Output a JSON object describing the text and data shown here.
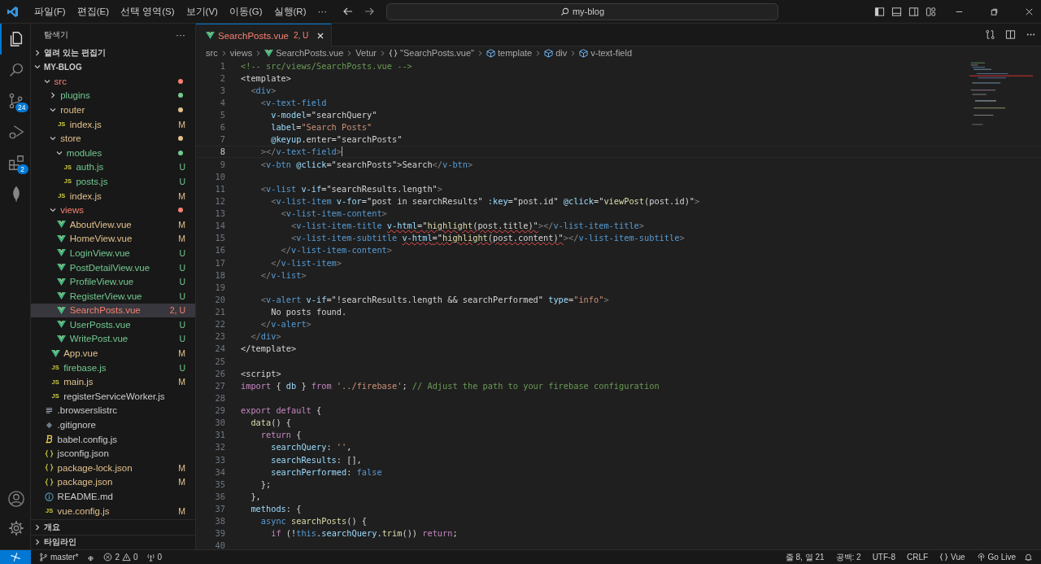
{
  "menu": [
    "파일(F)",
    "편집(E)",
    "선택 영역(S)",
    "보기(V)",
    "이동(G)",
    "실행(R)"
  ],
  "menu_more": "···",
  "command_center": {
    "value": "my-blog"
  },
  "activity_bar": [
    {
      "kind": "explorer",
      "selected": true
    },
    {
      "kind": "search",
      "selected": false
    },
    {
      "kind": "source-control",
      "selected": false,
      "badge": "24"
    },
    {
      "kind": "run",
      "selected": false
    },
    {
      "kind": "extensions",
      "selected": false,
      "badge": "2"
    },
    {
      "kind": "leaf",
      "selected": false
    }
  ],
  "activity_bottom": [
    {
      "kind": "account"
    },
    {
      "kind": "settings"
    }
  ],
  "explorer": {
    "title": "탐색기",
    "more": "···",
    "open_editors": {
      "label": "열려 있는 편집기",
      "expanded": false
    },
    "root": {
      "label": "MY-BLOG",
      "expanded": true
    },
    "tree": [
      {
        "name": "src",
        "kind": "folder",
        "color": "#f88070",
        "expanded": true,
        "selected": false,
        "children": [
          {
            "name": "plugins",
            "kind": "folder",
            "color": "#73c991",
            "expanded": false,
            "selected": false
          },
          {
            "name": "router",
            "kind": "folder",
            "color": "#e2c08d",
            "expanded": true,
            "selected": false,
            "children": [
              {
                "name": "index.js",
                "kind": "js",
                "icon_label": "JS",
                "color": "#e2c08d",
                "badge": "M",
                "selected": false
              }
            ]
          },
          {
            "name": "store",
            "kind": "folder",
            "color": "#e2c08d",
            "expanded": true,
            "selected": false,
            "children": [
              {
                "name": "modules",
                "kind": "folder",
                "color": "#73c991",
                "expanded": true,
                "selected": false,
                "children": [
                  {
                    "name": "auth.js",
                    "kind": "js",
                    "icon_label": "JS",
                    "color": "#73c991",
                    "badge": "U",
                    "selected": false
                  },
                  {
                    "name": "posts.js",
                    "kind": "js",
                    "icon_label": "JS",
                    "color": "#73c991",
                    "badge": "U",
                    "selected": false
                  }
                ]
              },
              {
                "name": "index.js",
                "kind": "js",
                "icon_label": "JS",
                "color": "#e2c08d",
                "badge": "M",
                "selected": false
              }
            ]
          },
          {
            "name": "views",
            "kind": "folder",
            "color": "#f88070",
            "expanded": true,
            "selected": false,
            "children": [
              {
                "name": "AboutView.vue",
                "kind": "vue",
                "color": "#e2c08d",
                "badge": "M",
                "selected": false
              },
              {
                "name": "HomeView.vue",
                "kind": "vue",
                "color": "#e2c08d",
                "badge": "M",
                "selected": false
              },
              {
                "name": "LoginView.vue",
                "kind": "vue",
                "color": "#73c991",
                "badge": "U",
                "selected": false
              },
              {
                "name": "PostDetailView.vue",
                "kind": "vue",
                "color": "#73c991",
                "badge": "U",
                "selected": false
              },
              {
                "name": "ProfileView.vue",
                "kind": "vue",
                "color": "#73c991",
                "badge": "U",
                "selected": false
              },
              {
                "name": "RegisterView.vue",
                "kind": "vue",
                "color": "#73c991",
                "badge": "U",
                "selected": false
              },
              {
                "name": "SearchPosts.vue",
                "kind": "vue",
                "color": "#f88070",
                "badge": "2, U",
                "selected": true
              },
              {
                "name": "UserPosts.vue",
                "kind": "vue",
                "color": "#73c991",
                "badge": "U",
                "selected": false
              },
              {
                "name": "WritePost.vue",
                "kind": "vue",
                "color": "#73c991",
                "badge": "U",
                "selected": false
              }
            ]
          },
          {
            "name": "App.vue",
            "kind": "vue",
            "color": "#e2c08d",
            "badge": "M",
            "selected": false
          },
          {
            "name": "firebase.js",
            "kind": "js",
            "icon_label": "JS",
            "color": "#73c991",
            "badge": "U",
            "selected": false
          },
          {
            "name": "main.js",
            "kind": "js",
            "icon_label": "JS",
            "color": "#e2c08d",
            "badge": "M",
            "selected": false
          },
          {
            "name": "registerServiceWorker.js",
            "kind": "js",
            "icon_label": "JS",
            "selected": false
          }
        ]
      },
      {
        "name": ".browserslistrc",
        "kind": "text",
        "selected": false
      },
      {
        "name": ".gitignore",
        "kind": "git",
        "selected": false
      },
      {
        "name": "babel.config.js",
        "kind": "babel",
        "selected": false
      },
      {
        "name": "jsconfig.json",
        "kind": "json",
        "selected": false
      },
      {
        "name": "package-lock.json",
        "kind": "json",
        "color": "#e2c08d",
        "badge": "M",
        "selected": false
      },
      {
        "name": "package.json",
        "kind": "json",
        "color": "#e2c08d",
        "badge": "M",
        "selected": false
      },
      {
        "name": "README.md",
        "kind": "info",
        "selected": false
      },
      {
        "name": "vue.config.js",
        "kind": "js",
        "icon_label": "JS",
        "color": "#e2c08d",
        "badge": "M",
        "selected": false
      }
    ],
    "bottom_sections": [
      {
        "label": "개요",
        "expanded": false
      },
      {
        "label": "타임라인",
        "expanded": false
      }
    ]
  },
  "tabs": [
    {
      "label": "SearchPosts.vue",
      "badge": "2, U",
      "color": "#f88070",
      "selected": true
    }
  ],
  "breadcrumb": [
    {
      "label": "src"
    },
    {
      "label": "views"
    },
    {
      "label": "SearchPosts.vue",
      "kind": "vue"
    },
    {
      "label": "Vetur"
    },
    {
      "label": "\"SearchPosts.vue\"",
      "kind": "braces"
    },
    {
      "label": "template",
      "kind": "cube"
    },
    {
      "label": "div",
      "kind": "cube"
    },
    {
      "label": "v-text-field",
      "kind": "cube"
    }
  ],
  "editor": {
    "lines": [
      {
        "number": "1",
        "current": false,
        "tokens": [
          {
            "kind": "comment",
            "text": "<!-- src/views/SearchPosts.vue -->"
          }
        ]
      },
      {
        "number": "2",
        "current": false,
        "tokens": [
          {
            "kind": "plain",
            "text": "<template>"
          }
        ]
      },
      {
        "number": "3",
        "current": false,
        "tokens": [
          {
            "kind": "punct",
            "text": "  <"
          },
          {
            "kind": "tag",
            "text": "div"
          },
          {
            "kind": "punct",
            "text": ">"
          }
        ]
      },
      {
        "number": "4",
        "current": false,
        "tokens": [
          {
            "kind": "punct",
            "text": "    <"
          },
          {
            "kind": "tag",
            "text": "v-text-field"
          }
        ]
      },
      {
        "number": "5",
        "current": false,
        "tokens": [
          {
            "kind": "attr",
            "text": "      v-model"
          },
          {
            "kind": "plain",
            "text": "=\"searchQuery\""
          }
        ]
      },
      {
        "number": "6",
        "current": false,
        "tokens": [
          {
            "kind": "attr",
            "text": "      label"
          },
          {
            "kind": "plain",
            "text": "="
          },
          {
            "kind": "string",
            "text": "\"Search Posts\""
          }
        ]
      },
      {
        "number": "7",
        "current": false,
        "tokens": [
          {
            "kind": "attr",
            "text": "      @keyup"
          },
          {
            "kind": "plain",
            "text": ".enter=\"searchPosts\""
          }
        ]
      },
      {
        "number": "8",
        "current": true,
        "tokens": [
          {
            "kind": "punct",
            "text": "    ></"
          },
          {
            "kind": "tag",
            "text": "v-text-field"
          },
          {
            "kind": "punct",
            "text": ">"
          }
        ]
      },
      {
        "number": "9",
        "current": false,
        "tokens": [
          {
            "kind": "punct",
            "text": "    <"
          },
          {
            "kind": "tag",
            "text": "v-btn"
          },
          {
            "kind": "attr",
            "text": " @click"
          },
          {
            "kind": "plain",
            "text": "=\"searchPosts\">Search"
          },
          {
            "kind": "punct",
            "text": "</"
          },
          {
            "kind": "tag",
            "text": "v-btn"
          },
          {
            "kind": "punct",
            "text": ">"
          }
        ]
      },
      {
        "number": "10",
        "current": false
      },
      {
        "number": "11",
        "current": false,
        "tokens": [
          {
            "kind": "punct",
            "text": "    <"
          },
          {
            "kind": "tag",
            "text": "v-list"
          },
          {
            "kind": "attr",
            "text": " v-if"
          },
          {
            "kind": "plain",
            "text": "=\"searchResults.length\""
          },
          {
            "kind": "punct",
            "text": ">"
          }
        ]
      },
      {
        "number": "12",
        "current": false,
        "tokens": [
          {
            "kind": "punct",
            "text": "      <"
          },
          {
            "kind": "tag",
            "text": "v-list-item"
          },
          {
            "kind": "attr",
            "text": " v-for"
          },
          {
            "kind": "plain",
            "text": "=\"post in searchResults\""
          },
          {
            "kind": "attr",
            "text": " :key"
          },
          {
            "kind": "plain",
            "text": "=\"post.id\""
          },
          {
            "kind": "attr",
            "text": " @click"
          },
          {
            "kind": "plain",
            "text": "=\""
          },
          {
            "kind": "func",
            "text": "viewPost"
          },
          {
            "kind": "plain",
            "text": "(post.id)\""
          },
          {
            "kind": "punct",
            "text": ">"
          }
        ]
      },
      {
        "number": "13",
        "current": false,
        "tokens": [
          {
            "kind": "punct",
            "text": "        <"
          },
          {
            "kind": "tag",
            "text": "v-list-item-content"
          },
          {
            "kind": "punct",
            "text": ">"
          }
        ]
      },
      {
        "number": "14",
        "current": false,
        "tokens": [
          {
            "kind": "punct",
            "text": "          <"
          },
          {
            "kind": "tag",
            "text": "v-list-item-title "
          },
          {
            "kind": "attr",
            "text": "v-html",
            "squiggle": true
          },
          {
            "kind": "plain",
            "text": "=\"",
            "squiggle": true
          },
          {
            "kind": "func",
            "text": "highlight",
            "squiggle": true
          },
          {
            "kind": "plain",
            "text": "(post.title)\"",
            "squiggle": true
          },
          {
            "kind": "punct",
            "text": "></"
          },
          {
            "kind": "tag",
            "text": "v-list-item-title"
          },
          {
            "kind": "punct",
            "text": ">"
          }
        ]
      },
      {
        "number": "15",
        "current": false,
        "tokens": [
          {
            "kind": "punct",
            "text": "          <"
          },
          {
            "kind": "tag",
            "text": "v-list-item-subtitle "
          },
          {
            "kind": "attr",
            "text": "v-html",
            "squiggle": true
          },
          {
            "kind": "plain",
            "text": "=\"",
            "squiggle": true
          },
          {
            "kind": "func",
            "text": "highlight",
            "squiggle": true
          },
          {
            "kind": "plain",
            "text": "(post.content)\"",
            "squiggle": true
          },
          {
            "kind": "punct",
            "text": "></"
          },
          {
            "kind": "tag",
            "text": "v-list-item-subtitle"
          },
          {
            "kind": "punct",
            "text": ">"
          }
        ]
      },
      {
        "number": "16",
        "current": false,
        "tokens": [
          {
            "kind": "punct",
            "text": "        </"
          },
          {
            "kind": "tag",
            "text": "v-list-item-content"
          },
          {
            "kind": "punct",
            "text": ">"
          }
        ]
      },
      {
        "number": "17",
        "current": false,
        "tokens": [
          {
            "kind": "punct",
            "text": "      </"
          },
          {
            "kind": "tag",
            "text": "v-list-item"
          },
          {
            "kind": "punct",
            "text": ">"
          }
        ]
      },
      {
        "number": "18",
        "current": false,
        "tokens": [
          {
            "kind": "punct",
            "text": "    </"
          },
          {
            "kind": "tag",
            "text": "v-list"
          },
          {
            "kind": "punct",
            "text": ">"
          }
        ]
      },
      {
        "number": "19",
        "current": false
      },
      {
        "number": "20",
        "current": false,
        "tokens": [
          {
            "kind": "punct",
            "text": "    <"
          },
          {
            "kind": "tag",
            "text": "v-alert"
          },
          {
            "kind": "attr",
            "text": " v-if"
          },
          {
            "kind": "plain",
            "text": "=\"!searchResults.length && searchPerformed\""
          },
          {
            "kind": "attr",
            "text": " type"
          },
          {
            "kind": "plain",
            "text": "="
          },
          {
            "kind": "string",
            "text": "\"info\""
          },
          {
            "kind": "punct",
            "text": ">"
          }
        ]
      },
      {
        "number": "21",
        "current": false,
        "tokens": [
          {
            "kind": "plain",
            "text": "      No posts found."
          }
        ]
      },
      {
        "number": "22",
        "current": false,
        "tokens": [
          {
            "kind": "punct",
            "text": "    </"
          },
          {
            "kind": "tag",
            "text": "v-alert"
          },
          {
            "kind": "punct",
            "text": ">"
          }
        ]
      },
      {
        "number": "23",
        "current": false,
        "tokens": [
          {
            "kind": "punct",
            "text": "  </"
          },
          {
            "kind": "tag",
            "text": "div"
          },
          {
            "kind": "punct",
            "text": ">"
          }
        ]
      },
      {
        "number": "24",
        "current": false,
        "tokens": [
          {
            "kind": "plain",
            "text": "</template>"
          }
        ]
      },
      {
        "number": "25",
        "current": false
      },
      {
        "number": "26",
        "current": false,
        "tokens": [
          {
            "kind": "plain",
            "text": "<script>"
          }
        ]
      },
      {
        "number": "27",
        "current": false,
        "tokens": [
          {
            "kind": "keyword",
            "text": "import"
          },
          {
            "kind": "plain",
            "text": " { "
          },
          {
            "kind": "var",
            "text": "db"
          },
          {
            "kind": "plain",
            "text": " } "
          },
          {
            "kind": "keyword",
            "text": "from "
          },
          {
            "kind": "string",
            "text": "'../firebase'"
          },
          {
            "kind": "plain",
            "text": "; "
          },
          {
            "kind": "comment",
            "text": "// Adjust the path to your firebase configuration"
          }
        ]
      },
      {
        "number": "28",
        "current": false
      },
      {
        "number": "29",
        "current": false,
        "tokens": [
          {
            "kind": "keyword",
            "text": "export default"
          },
          {
            "kind": "plain",
            "text": " {"
          }
        ]
      },
      {
        "number": "30",
        "current": false,
        "tokens": [
          {
            "kind": "func",
            "text": "  data"
          },
          {
            "kind": "plain",
            "text": "() {"
          }
        ]
      },
      {
        "number": "31",
        "current": false,
        "tokens": [
          {
            "kind": "keyword",
            "text": "    return"
          },
          {
            "kind": "plain",
            "text": " {"
          }
        ]
      },
      {
        "number": "32",
        "current": false,
        "tokens": [
          {
            "kind": "var",
            "text": "      searchQuery"
          },
          {
            "kind": "plain",
            "text": ": "
          },
          {
            "kind": "string",
            "text": "''"
          },
          {
            "kind": "plain",
            "text": ","
          }
        ]
      },
      {
        "number": "33",
        "current": false,
        "tokens": [
          {
            "kind": "var",
            "text": "      searchResults"
          },
          {
            "kind": "plain",
            "text": ": [],"
          }
        ]
      },
      {
        "number": "34",
        "current": false,
        "tokens": [
          {
            "kind": "var",
            "text": "      searchPerformed"
          },
          {
            "kind": "plain",
            "text": ": "
          },
          {
            "kind": "const",
            "text": "false"
          }
        ]
      },
      {
        "number": "35",
        "current": false,
        "tokens": [
          {
            "kind": "plain",
            "text": "    };"
          }
        ]
      },
      {
        "number": "36",
        "current": false,
        "tokens": [
          {
            "kind": "plain",
            "text": "  },"
          }
        ]
      },
      {
        "number": "37",
        "current": false,
        "tokens": [
          {
            "kind": "var",
            "text": "  methods"
          },
          {
            "kind": "plain",
            "text": ": {"
          }
        ]
      },
      {
        "number": "38",
        "current": false,
        "tokens": [
          {
            "kind": "const",
            "text": "    async "
          },
          {
            "kind": "func",
            "text": "searchPosts"
          },
          {
            "kind": "plain",
            "text": "() {"
          }
        ]
      },
      {
        "number": "39",
        "current": false,
        "tokens": [
          {
            "kind": "keyword",
            "text": "      if"
          },
          {
            "kind": "plain",
            "text": " (!"
          },
          {
            "kind": "const",
            "text": "this"
          },
          {
            "kind": "plain",
            "text": "."
          },
          {
            "kind": "var",
            "text": "searchQuery"
          },
          {
            "kind": "plain",
            "text": "."
          },
          {
            "kind": "func",
            "text": "trim"
          },
          {
            "kind": "plain",
            "text": "()) "
          },
          {
            "kind": "keyword",
            "text": "return"
          },
          {
            "kind": "plain",
            "text": ";"
          }
        ]
      },
      {
        "number": "40",
        "current": false
      }
    ]
  },
  "status_bar": {
    "branch": "master*",
    "errors": "2",
    "warnings": "0",
    "ports": "0",
    "right": [
      {
        "text": "줄 8, 열 21"
      },
      {
        "text": "공백: 2"
      },
      {
        "text": "UTF-8"
      },
      {
        "text": "CRLF"
      },
      {
        "text": "Vue",
        "kind": "braces"
      },
      {
        "text": "Go Live",
        "kind": "broadcast"
      }
    ]
  }
}
